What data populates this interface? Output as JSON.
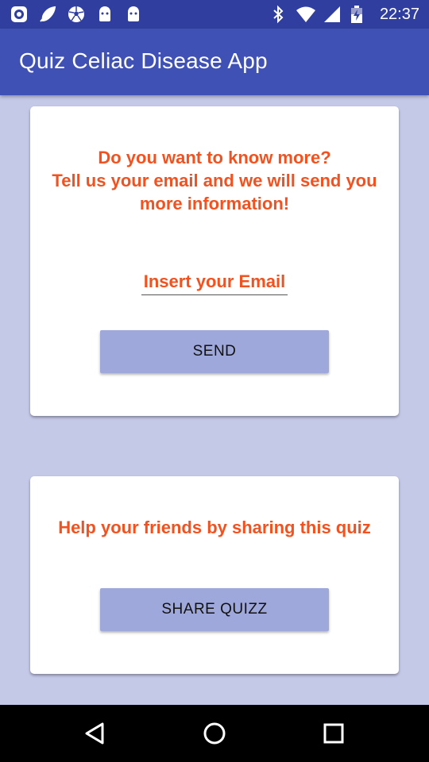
{
  "status_bar": {
    "time": "22:37",
    "left_icons": [
      "app-notification-icon",
      "leaf-notification-icon",
      "soccer-ball-icon",
      "android-icon",
      "android-icon"
    ],
    "right_icons": [
      "bluetooth-icon",
      "wifi-icon",
      "signal-icon",
      "battery-charging-icon"
    ]
  },
  "app_bar": {
    "title": "Quiz Celiac Disease App"
  },
  "email_card": {
    "message": "Do you want to know more?\nTell us your email and we will send you more information!",
    "email_placeholder": "Insert your Email",
    "send_label": "SEND"
  },
  "share_card": {
    "message": "Help your friends by sharing this quiz",
    "share_label": "SHARE QUIZZ"
  },
  "nav_bar": {
    "icons": [
      "back-icon",
      "home-icon",
      "recents-icon"
    ]
  },
  "colors": {
    "primary": "#3f51b5",
    "primary_dark": "#303f9f",
    "accent_text": "#f4511e",
    "button": "#9fa8da",
    "background": "#c5c9e8"
  }
}
